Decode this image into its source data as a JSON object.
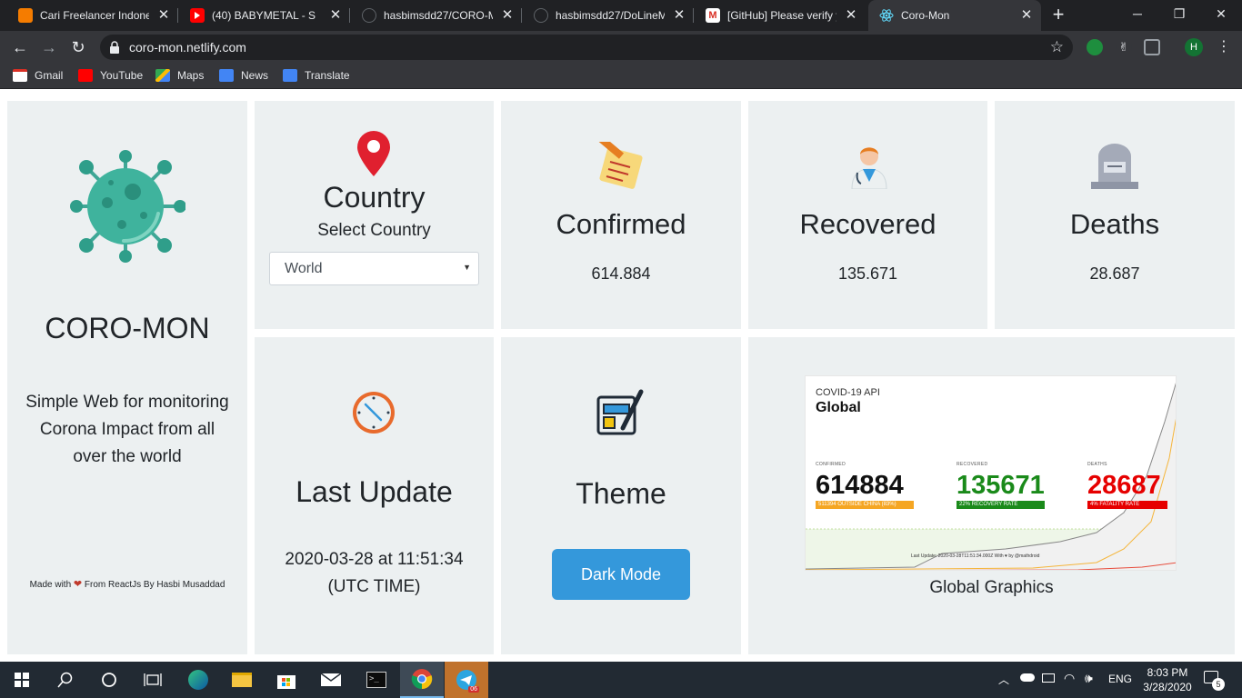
{
  "browser": {
    "tabs": [
      {
        "title": "Cari Freelancer Indones",
        "icon": "freelancer-icon"
      },
      {
        "title": "(40) BABYMETAL - S",
        "icon": "youtube-icon"
      },
      {
        "title": "hasbimsdd27/CORO-M",
        "icon": "github-icon"
      },
      {
        "title": "hasbimsdd27/DoLineM",
        "icon": "github-icon"
      },
      {
        "title": "[GitHub] Please verify y",
        "icon": "gmail-icon"
      },
      {
        "title": "Coro-Mon",
        "icon": "react-icon"
      }
    ],
    "new_tab": "+",
    "url": "coro-mon.netlify.com",
    "profile_initial": "H",
    "bookmarks": [
      {
        "label": "Gmail",
        "icon": "gmail-icon"
      },
      {
        "label": "YouTube",
        "icon": "youtube-icon"
      },
      {
        "label": "Maps",
        "icon": "maps-icon"
      },
      {
        "label": "News",
        "icon": "news-icon"
      },
      {
        "label": "Translate",
        "icon": "translate-icon"
      }
    ]
  },
  "about": {
    "title": "CORO-MON",
    "description": "Simple Web for monitoring Corona Impact from all over the world",
    "footer_prefix": "Made with",
    "footer_suffix": "From ReactJs By Hasbi Musaddad"
  },
  "country": {
    "title": "Country",
    "subtitle": "Select Country",
    "selected": "World"
  },
  "stats": {
    "confirmed": {
      "label": "Confirmed",
      "value": "614.884"
    },
    "recovered": {
      "label": "Recovered",
      "value": "135.671"
    },
    "deaths": {
      "label": "Deaths",
      "value": "28.687"
    }
  },
  "last_update": {
    "title": "Last Update",
    "datetime": "2020-03-28 at 11:51:34",
    "zone": "(UTC TIME)"
  },
  "theme": {
    "title": "Theme",
    "button": "Dark Mode"
  },
  "graphic": {
    "api_label": "COVID-19 API",
    "heading": "Global",
    "confirmed_label": "CONFIRMED",
    "confirmed_value": "614884",
    "confirmed_note": "511394 OUTSIDE CHINA (83%)",
    "recovered_label": "RECOVERED",
    "recovered_value": "135671",
    "recovered_note": "22% RECOVERY RATE",
    "deaths_label": "DEATHS",
    "deaths_value": "28687",
    "deaths_note": "4% FATALITY RATE",
    "footer": "Last Update: 2020-03-28T11:51:34.000Z With ♥ by @mathdroid",
    "caption": "Global Graphics",
    "colors": {
      "confirmed": "#111111",
      "recovered": "#1a8a1a",
      "deaths": "#e60000",
      "note_confirmed": "#f5a623"
    }
  },
  "taskbar": {
    "language": "ENG",
    "time": "8:03 PM",
    "date": "3/28/2020",
    "notifications": "5",
    "telegram_badge": "06"
  }
}
